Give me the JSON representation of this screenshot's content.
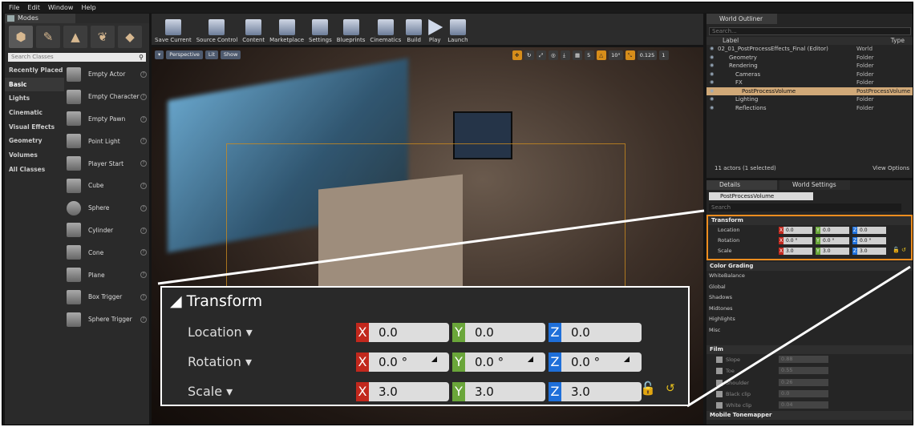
{
  "menu": [
    "File",
    "Edit",
    "Window",
    "Help"
  ],
  "modes": {
    "tab": "Modes",
    "search_placeholder": "Search Classes",
    "categories": [
      "Recently Placed",
      "Basic",
      "Lights",
      "Cinematic",
      "Visual Effects",
      "Geometry",
      "Volumes",
      "All Classes"
    ],
    "selected_category": "Basic",
    "items": [
      "Empty Actor",
      "Empty Character",
      "Empty Pawn",
      "Point Light",
      "Player Start",
      "Cube",
      "Sphere",
      "Cylinder",
      "Cone",
      "Plane",
      "Box Trigger",
      "Sphere Trigger"
    ]
  },
  "toolbar": [
    "Save Current",
    "Source Control",
    "Content",
    "Marketplace",
    "Settings",
    "Blueprints",
    "Cinematics",
    "Build",
    "Play",
    "Launch"
  ],
  "viewport": {
    "buttons": [
      "Perspective",
      "Lit",
      "Show"
    ],
    "grid": "5",
    "angle": "10°",
    "scale": "0.125",
    "cam": "1"
  },
  "zoom": {
    "heading": "Transform",
    "location_label": "Location",
    "rotation_label": "Rotation",
    "scale_label": "Scale",
    "location": [
      "0.0",
      "0.0",
      "0.0"
    ],
    "rotation": [
      "0.0 °",
      "0.0 °",
      "0.0 °"
    ],
    "scale": [
      "3.0",
      "3.0",
      "3.0"
    ]
  },
  "outliner": {
    "tab": "World Outliner",
    "search_placeholder": "Search...",
    "col_label": "Label",
    "col_type": "Type",
    "rows": [
      {
        "name": "02_01_PostProcessEffects_Final (Editor)",
        "type": "World"
      },
      {
        "name": "Geometry",
        "type": "Folder"
      },
      {
        "name": "Rendering",
        "type": "Folder"
      },
      {
        "name": "Cameras",
        "type": "Folder"
      },
      {
        "name": "FX",
        "type": "Folder"
      },
      {
        "name": "PostProcessVolume",
        "type": "PostProcessVolume"
      },
      {
        "name": "Lighting",
        "type": "Folder"
      },
      {
        "name": "Reflections",
        "type": "Folder"
      }
    ],
    "count": "11 actors (1 selected)",
    "view_options": "View Options"
  },
  "details": {
    "tab": "Details",
    "tab2": "World Settings",
    "actor_name": "PostProcessVolume",
    "search_placeholder": "Search",
    "transform": "Transform",
    "location_label": "Location",
    "rotation_label": "Rotation",
    "scale_label": "Scale",
    "location": [
      "0.0",
      "0.0",
      "0.0"
    ],
    "rotation": [
      "0.0 °",
      "0.0 °",
      "0.0 °"
    ],
    "scale": [
      "3.0",
      "3.0",
      "3.0"
    ],
    "color_grading": "Color Grading",
    "subs": [
      "WhiteBalance",
      "Global",
      "Shadows",
      "Midtones",
      "Highlights",
      "Misc"
    ],
    "film": "Film",
    "film_rows": [
      {
        "label": "Slope",
        "value": "0.88"
      },
      {
        "label": "Toe",
        "value": "0.55"
      },
      {
        "label": "Shoulder",
        "value": "0.26"
      },
      {
        "label": "Black clip",
        "value": "0.0"
      },
      {
        "label": "White clip",
        "value": "0.04"
      }
    ],
    "mobile": "Mobile Tonemapper"
  }
}
